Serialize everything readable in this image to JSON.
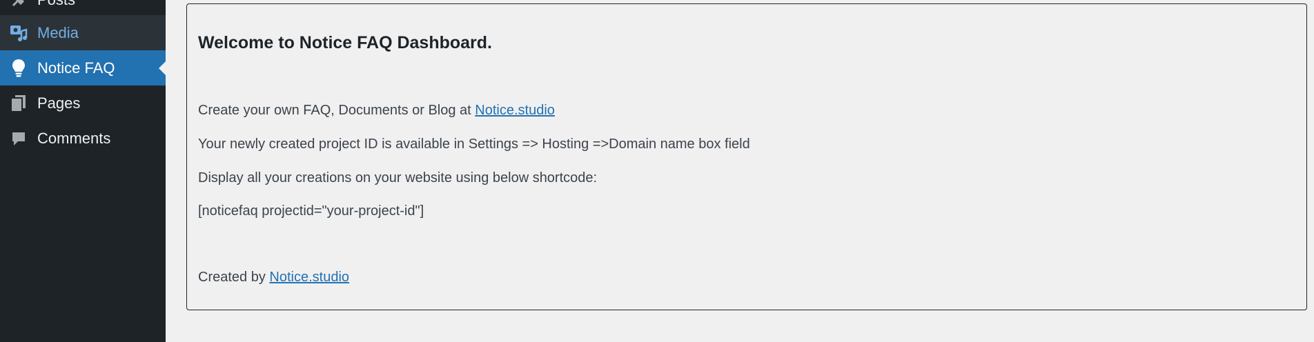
{
  "sidebar": {
    "items": [
      {
        "label": "Posts",
        "icon": "pin-icon"
      },
      {
        "label": "Media",
        "icon": "media-icon"
      },
      {
        "label": "Notice FAQ",
        "icon": "lightbulb-icon"
      },
      {
        "label": "Pages",
        "icon": "pages-icon"
      },
      {
        "label": "Comments",
        "icon": "comment-icon"
      }
    ]
  },
  "main": {
    "title": "Welcome to Notice FAQ Dashboard.",
    "line1_prefix": "Create your own FAQ, Documents or Blog at ",
    "line1_link": "Notice.studio",
    "line2": "Your newly created project ID is available in Settings => Hosting =>Domain name box field",
    "line3": "Display all your creations on your website using below shortcode:",
    "line4": "[noticefaq projectid=\"your-project-id\"]",
    "line5_prefix": "Created by ",
    "line5_link": "Notice.studio"
  },
  "colors": {
    "sidebar_bg": "#1d2327",
    "active_bg": "#2271b1",
    "media_text": "#72aee6",
    "link": "#2271b1",
    "page_bg": "#f0f0f1"
  }
}
